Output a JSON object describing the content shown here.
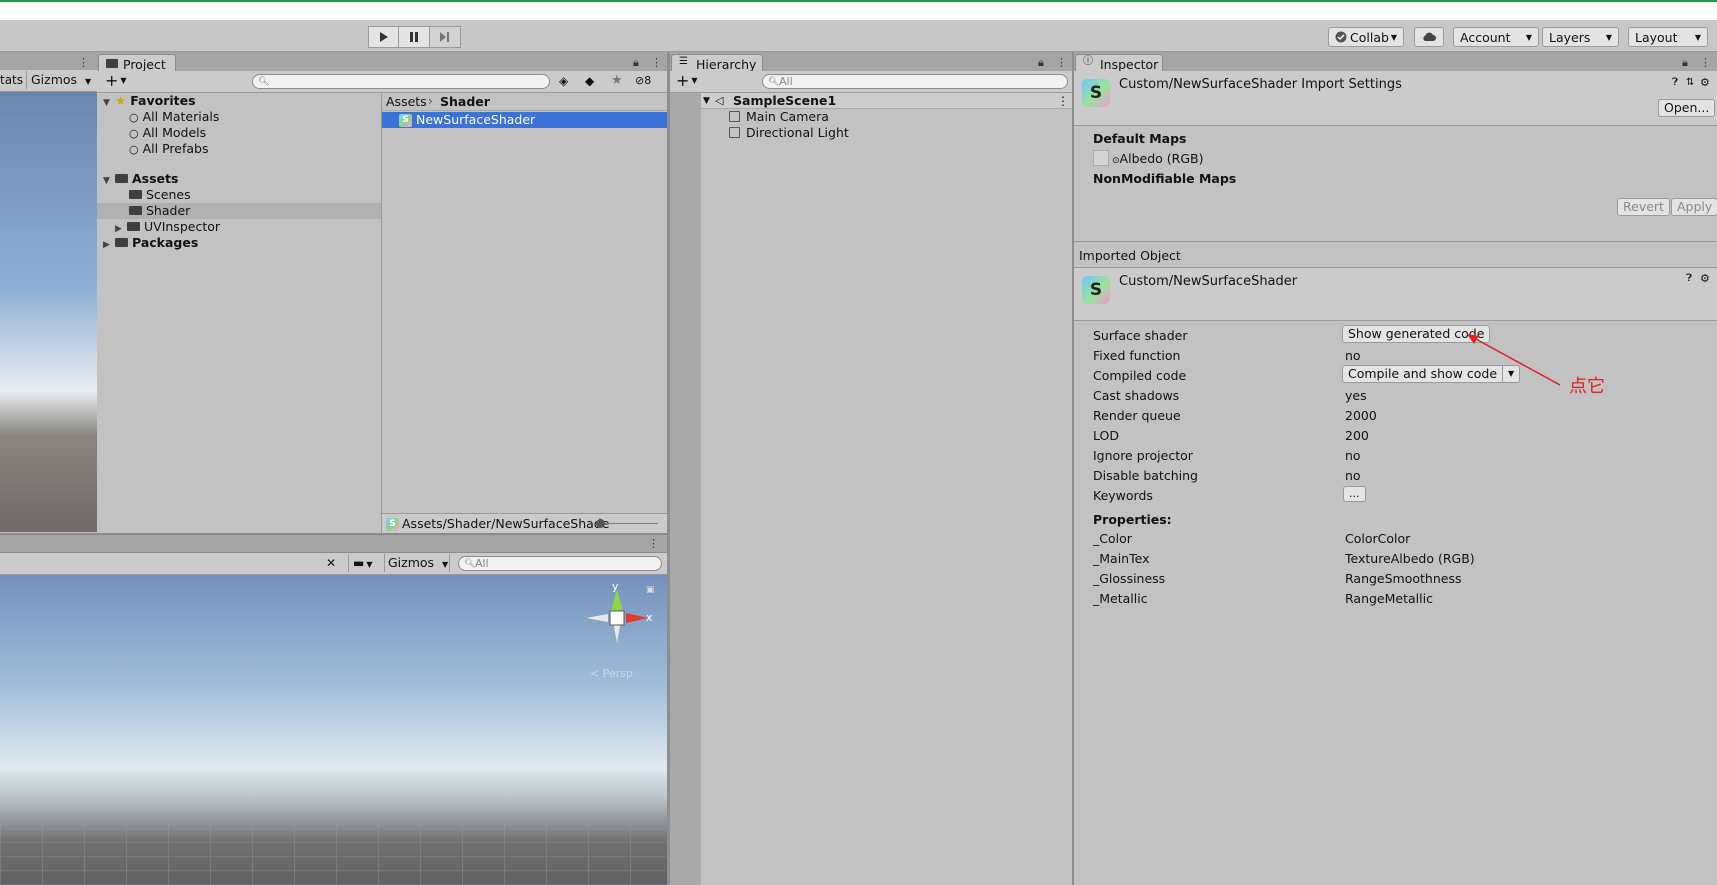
{
  "toolbar": {
    "collab_label": "Collab",
    "account_label": "Account",
    "layers_label": "Layers",
    "layout_label": "Layout"
  },
  "scene_top": {
    "stats_label": "tats",
    "gizmos_label": "Gizmos"
  },
  "project": {
    "tab_label": "Project",
    "hidden_count": "8",
    "favorites_label": "Favorites",
    "favorites": [
      "All Materials",
      "All Models",
      "All Prefabs"
    ],
    "assets_label": "Assets",
    "asset_folders": [
      "Scenes",
      "Shader",
      "UVInspector"
    ],
    "packages_label": "Packages",
    "breadcrumb": [
      "Assets",
      "Shader"
    ],
    "file_name": "NewSurfaceShader",
    "status_path": "Assets/Shader/NewSurfaceShade"
  },
  "hierarchy": {
    "tab_label": "Hierarchy",
    "search_placeholder": "All",
    "scene_name": "SampleScene1",
    "objects": [
      "Main Camera",
      "Directional Light"
    ]
  },
  "scene_bottom": {
    "gizmos_label": "Gizmos",
    "search_placeholder": "All",
    "axis_y": "y",
    "axis_x": "x",
    "persp_label": "< Persp"
  },
  "inspector": {
    "tab_label": "Inspector",
    "header_title": "Custom/NewSurfaceShader Import Settings",
    "open_button": "Open...",
    "default_maps_label": "Default Maps",
    "albedo_label": "Albedo (RGB)",
    "nonmodifiable_label": "NonModifiable Maps",
    "revert_button": "Revert",
    "apply_button": "Apply",
    "imported_object_label": "Imported Object",
    "object_title": "Custom/NewSurfaceShader",
    "rows": [
      {
        "label": "Surface shader",
        "value": "Show generated code"
      },
      {
        "label": "Fixed function",
        "value": "no"
      },
      {
        "label": "Compiled code",
        "value": "Compile and show code"
      },
      {
        "label": "Cast shadows",
        "value": "yes"
      },
      {
        "label": "Render queue",
        "value": "2000"
      },
      {
        "label": "LOD",
        "value": "200"
      },
      {
        "label": "Ignore projector",
        "value": "no"
      },
      {
        "label": "Disable batching",
        "value": "no"
      },
      {
        "label": "Keywords",
        "value": "..."
      }
    ],
    "properties_label": "Properties:",
    "properties": [
      {
        "name": "_Color",
        "value": "ColorColor"
      },
      {
        "name": "_MainTex",
        "value": "TextureAlbedo (RGB)"
      },
      {
        "name": "_Glossiness",
        "value": "RangeSmoothness"
      },
      {
        "name": "_Metallic",
        "value": "RangeMetallic"
      }
    ]
  },
  "annotation": {
    "text": "点它",
    "color": "#e02020"
  }
}
